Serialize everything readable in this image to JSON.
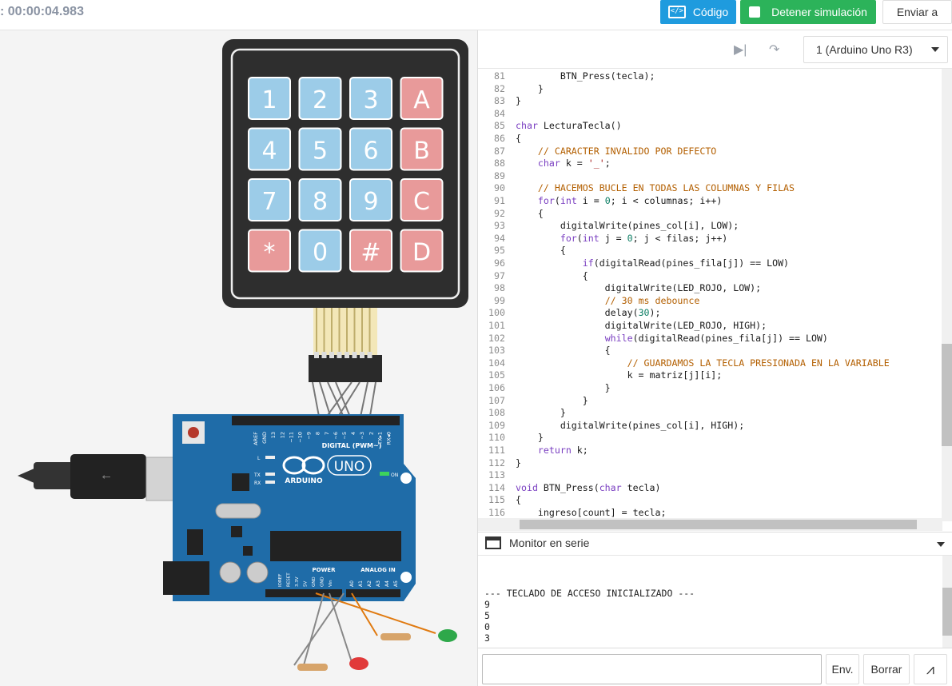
{
  "topbar": {
    "timer": ": 00:00:04.983",
    "code_label": "Código",
    "stop_label": "Detener simulación",
    "send_label": "Enviar a"
  },
  "circuit": {
    "keypad_keys": [
      "1",
      "2",
      "3",
      "A",
      "4",
      "5",
      "6",
      "B",
      "7",
      "8",
      "9",
      "C",
      "*",
      "0",
      "#",
      "D"
    ],
    "board_brand": "ARDUINO",
    "board_model": "UNO",
    "digital_label": "DIGITAL (PWM~)",
    "power_label": "POWER",
    "analog_label": "ANALOG IN",
    "on_label": "ON",
    "tx_label": "TX",
    "rx_label": "RX",
    "l_label": "L",
    "digital_pins": [
      "AREF",
      "GND",
      "13",
      "12",
      "~11",
      "~10",
      "~9",
      "8",
      "7",
      "~6",
      "~5",
      "4",
      "~3",
      "2",
      "TX▸1",
      "RX◂0"
    ],
    "power_pins": [
      "IOREF",
      "RESET",
      "3.3V",
      "5V",
      "GND",
      "GND",
      "Vin"
    ],
    "analog_pins": [
      "A0",
      "A1",
      "A2",
      "A3",
      "A4",
      "A5"
    ]
  },
  "colors": {
    "key_blue": "#9ccce8",
    "key_red": "#e89a9a",
    "board": "#1f6ca8",
    "btn_code": "#1f9bde",
    "btn_stop": "#2cb35a"
  },
  "editor": {
    "device": "1 (Arduino Uno R3)",
    "lines": [
      {
        "n": "81",
        "t": "        BTN_Press(tecla);"
      },
      {
        "n": "82",
        "t": "    }"
      },
      {
        "n": "83",
        "t": "}"
      },
      {
        "n": "84",
        "t": ""
      },
      {
        "n": "85",
        "t": "char LecturaTecla()"
      },
      {
        "n": "86",
        "t": "{"
      },
      {
        "n": "87",
        "t": "    // CARACTER INVALIDO POR DEFECTO"
      },
      {
        "n": "88",
        "t": "    char k = '_';"
      },
      {
        "n": "89",
        "t": ""
      },
      {
        "n": "90",
        "t": "    // HACEMOS BUCLE EN TODAS LAS COLUMNAS Y FILAS"
      },
      {
        "n": "91",
        "t": "    for(int i = 0; i < columnas; i++)"
      },
      {
        "n": "92",
        "t": "    {"
      },
      {
        "n": "93",
        "t": "        digitalWrite(pines_col[i], LOW);"
      },
      {
        "n": "94",
        "t": "        for(int j = 0; j < filas; j++)"
      },
      {
        "n": "95",
        "t": "        {"
      },
      {
        "n": "96",
        "t": "            if(digitalRead(pines_fila[j]) == LOW)"
      },
      {
        "n": "97",
        "t": "            {"
      },
      {
        "n": "98",
        "t": "                digitalWrite(LED_ROJO, LOW);"
      },
      {
        "n": "99",
        "t": "                // 30 ms debounce"
      },
      {
        "n": "100",
        "t": "                delay(30);"
      },
      {
        "n": "101",
        "t": "                digitalWrite(LED_ROJO, HIGH);"
      },
      {
        "n": "102",
        "t": "                while(digitalRead(pines_fila[j]) == LOW)"
      },
      {
        "n": "103",
        "t": "                {"
      },
      {
        "n": "104",
        "t": "                    // GUARDAMOS LA TECLA PRESIONADA EN LA VARIABLE"
      },
      {
        "n": "105",
        "t": "                    k = matriz[j][i];"
      },
      {
        "n": "106",
        "t": "                }"
      },
      {
        "n": "107",
        "t": "            }"
      },
      {
        "n": "108",
        "t": "        }"
      },
      {
        "n": "109",
        "t": "        digitalWrite(pines_col[i], HIGH);"
      },
      {
        "n": "110",
        "t": "    }"
      },
      {
        "n": "111",
        "t": "    return k;"
      },
      {
        "n": "112",
        "t": "}"
      },
      {
        "n": "113",
        "t": ""
      },
      {
        "n": "114",
        "t": "void BTN_Press(char tecla)"
      },
      {
        "n": "115",
        "t": "{"
      },
      {
        "n": "116",
        "t": "    ingreso[count] = tecla;"
      }
    ]
  },
  "monitor": {
    "title": "Monitor en serie",
    "lines": [
      "--- TECLADO DE ACCESO INICIALIZADO ---",
      "9",
      "5",
      "0",
      "3"
    ],
    "input_value": "",
    "send_label": "Env.",
    "clear_label": "Borrar"
  }
}
